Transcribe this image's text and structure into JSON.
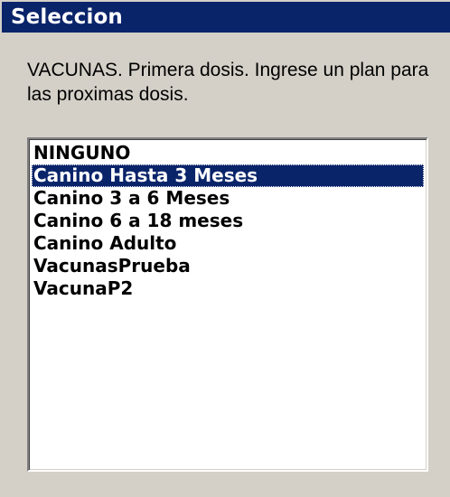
{
  "window": {
    "title": "Seleccion"
  },
  "prompt": {
    "text": "VACUNAS. Primera dosis. Ingrese un plan para las proximas dosis."
  },
  "list": {
    "selected_index": 1,
    "items": [
      {
        "label": "NINGUNO"
      },
      {
        "label": "Canino Hasta 3 Meses"
      },
      {
        "label": "Canino 3 a 6 Meses"
      },
      {
        "label": "Canino 6 a 18 meses"
      },
      {
        "label": "Canino Adulto"
      },
      {
        "label": "VacunasPrueba"
      },
      {
        "label": "VacunaP2"
      }
    ]
  },
  "colors": {
    "titlebar": "#0a246a",
    "window_bg": "#d4d0c8",
    "selection": "#0a246a"
  }
}
